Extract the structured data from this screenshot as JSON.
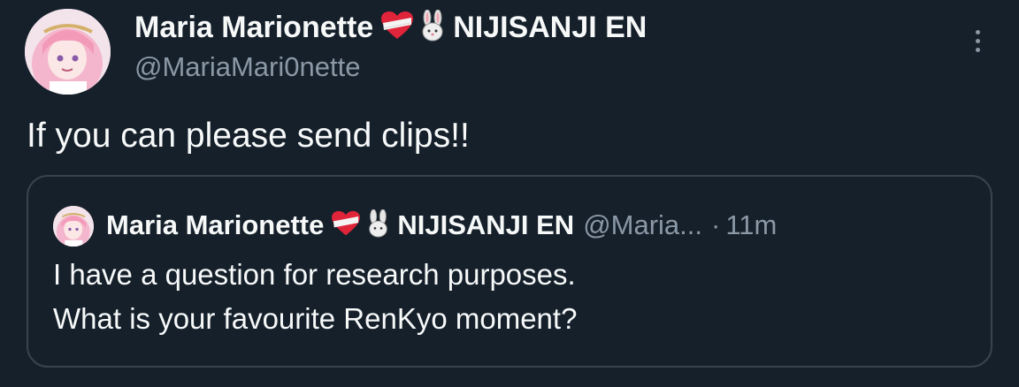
{
  "tweet": {
    "author": {
      "display_name": "Maria Marionette",
      "affiliation": "NIJISANJI EN",
      "handle": "@MariaMari0nette",
      "avatar_icon": "anime-avatar",
      "badges": [
        "bandaged-heart-emoji",
        "rabbit-face-emoji"
      ]
    },
    "text": "If you can please send clips!!",
    "quote": {
      "author": {
        "display_name": "Maria Marionette",
        "affiliation": "NIJISANJI EN",
        "handle": "@Maria...",
        "avatar_icon": "anime-avatar"
      },
      "separator": "·",
      "time": "11m",
      "lines": [
        "I have a question for research purposes.",
        "What is your favourite RenKyo moment?"
      ]
    }
  },
  "colors": {
    "background": "#15202b",
    "primary_text": "#f7f9f9",
    "secondary_text": "#8b98a5",
    "border": "#38444d",
    "avatar_hair": "#f4b6cc"
  }
}
